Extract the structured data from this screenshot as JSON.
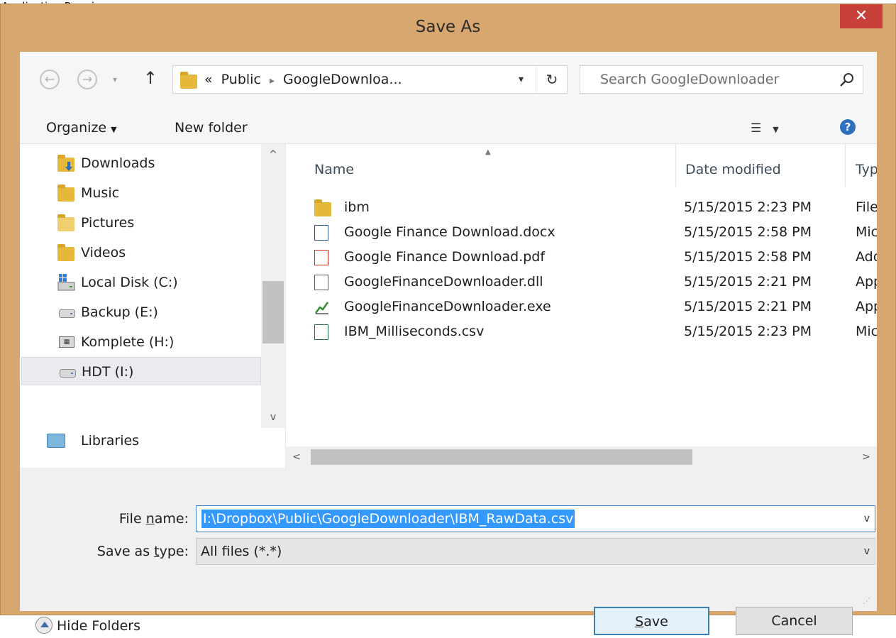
{
  "caption": "Application Running",
  "window": {
    "title": "Save As",
    "close_glyph": "✕"
  },
  "nav": {
    "back_glyph": "←",
    "forward_glyph": "→",
    "history_glyph": "▾",
    "up_glyph": "↑"
  },
  "address": {
    "prefix": "«",
    "crumbs": [
      "Public",
      "GoogleDownloa..."
    ],
    "separator": "▸",
    "dropdown_glyph": "▾",
    "refresh_glyph": "↻"
  },
  "search": {
    "placeholder": "Search GoogleDownloader",
    "icon": "search-icon"
  },
  "toolbar": {
    "organize": "Organize",
    "organize_caret": "▼",
    "new_folder": "New folder",
    "view_glyph": "☰",
    "view_caret": "▼",
    "help_glyph": "?"
  },
  "sidebar": {
    "items": [
      {
        "label": "Downloads",
        "icon": "downloads-folder-icon"
      },
      {
        "label": "Music",
        "icon": "music-folder-icon"
      },
      {
        "label": "Pictures",
        "icon": "pictures-folder-icon"
      },
      {
        "label": "Videos",
        "icon": "videos-folder-icon"
      },
      {
        "label": "Local Disk (C:)",
        "icon": "system-drive-icon"
      },
      {
        "label": "Backup (E:)",
        "icon": "drive-icon"
      },
      {
        "label": "Komplete (H:)",
        "icon": "network-drive-icon"
      },
      {
        "label": "HDT (I:)",
        "icon": "drive-icon",
        "selected": true
      }
    ],
    "libraries": "Libraries",
    "scroll_up_glyph": "^",
    "scroll_down_glyph": "v"
  },
  "files": {
    "columns": {
      "name": "Name",
      "date": "Date modified",
      "type": "Typ"
    },
    "sort_glyph": "▲",
    "rows": [
      {
        "name": "ibm",
        "date": "5/15/2015 2:23 PM",
        "type": "File",
        "icon": "folder-icon"
      },
      {
        "name": "Google Finance Download.docx",
        "date": "5/15/2015 2:58 PM",
        "type": "Mic",
        "icon": "word-document-icon"
      },
      {
        "name": "Google Finance Download.pdf",
        "date": "5/15/2015 2:58 PM",
        "type": "Ado",
        "icon": "pdf-icon"
      },
      {
        "name": "GoogleFinanceDownloader.dll",
        "date": "5/15/2015 2:21 PM",
        "type": "App",
        "icon": "dll-icon"
      },
      {
        "name": "GoogleFinanceDownloader.exe",
        "date": "5/15/2015 2:21 PM",
        "type": "App",
        "icon": "exe-chart-icon"
      },
      {
        "name": "IBM_Milliseconds.csv",
        "date": "5/15/2015 2:23 PM",
        "type": "Mic",
        "icon": "excel-csv-icon"
      }
    ],
    "scroll_left_glyph": "<",
    "scroll_right_glyph": ">"
  },
  "form": {
    "file_name_pre": "File ",
    "file_name_key": "n",
    "file_name_post": "ame:",
    "file_name_value": "I:\\Dropbox\\Public\\GoogleDownloader\\IBM_RawData.csv",
    "save_type_pre": "Save as ",
    "save_type_key": "t",
    "save_type_post": "ype:",
    "save_type_value": "All files (*.*)",
    "dropdown_glyph": "v"
  },
  "footer": {
    "hide_folders": "Hide Folders",
    "save_key": "S",
    "save_rest": "ave",
    "cancel": "Cancel",
    "grip_glyph": "⋰"
  },
  "colors": {
    "frame": "#d7a76f",
    "close": "#c7413a",
    "selection": "#3399ff",
    "default_button_border": "#3c7fb1"
  }
}
